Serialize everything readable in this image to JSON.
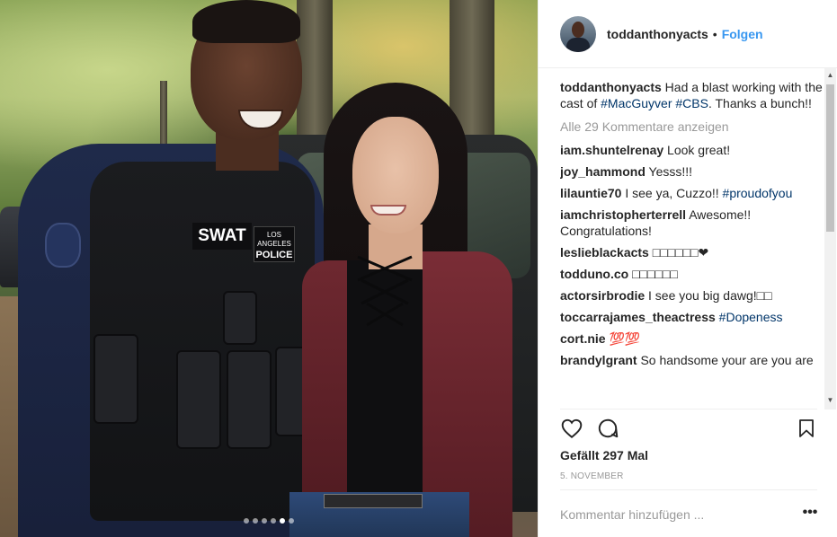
{
  "post": {
    "username": "toddanthonyacts",
    "separator": "•",
    "follow_label": "Folgen",
    "caption": {
      "username": "toddanthonyacts",
      "text_1": "Had a blast working with the cast of ",
      "tag_1": "#MacGuyver",
      "text_2": " ",
      "tag_2": "#CBS",
      "text_3": ". Thanks a bunch!!"
    },
    "view_all_label": "Alle 29 Kommentare anzeigen",
    "comments": [
      {
        "user": "iam.shuntelrenay",
        "text": "Look great!",
        "tag": ""
      },
      {
        "user": "joy_hammond",
        "text": "Yesss!!!",
        "tag": ""
      },
      {
        "user": "lilauntie70",
        "text": "I see ya, Cuzzo!! ",
        "tag": "#proudofyou"
      },
      {
        "user": "iamchristopherterrell",
        "text": "Awesome!! Congratulations!",
        "tag": ""
      },
      {
        "user": "leslieblackacts",
        "text": "□□□□□□❤",
        "tag": ""
      },
      {
        "user": "todduno.co",
        "text": "□□□□□□",
        "tag": ""
      },
      {
        "user": "actorsirbrodie",
        "text": "I see you big dawg!□□",
        "tag": ""
      },
      {
        "user": "toccarrajames_theactress",
        "text": "",
        "tag": "#Dopeness"
      },
      {
        "user": "cort.nie",
        "text": "💯💯",
        "tag": ""
      },
      {
        "user": "brandylgrant",
        "text": "So handsome your are you are",
        "tag": ""
      }
    ],
    "likes_label": "Gefällt 297 Mal",
    "date_label": "5. NOVEMBER",
    "comment_placeholder": "Kommentar hinzufügen ...",
    "more_label": "•••"
  },
  "photo": {
    "swat_text": "SWAT",
    "police_line1": "LOS ANGELES",
    "police_line2": "POLICE",
    "carousel_total": 6,
    "carousel_active": 5
  },
  "colors": {
    "link_blue": "#3897f0",
    "hashtag": "#003569",
    "muted": "#999999",
    "text": "#262626"
  },
  "icons": [
    "heart-icon",
    "comment-icon",
    "bookmark-icon",
    "more-options-icon"
  ]
}
